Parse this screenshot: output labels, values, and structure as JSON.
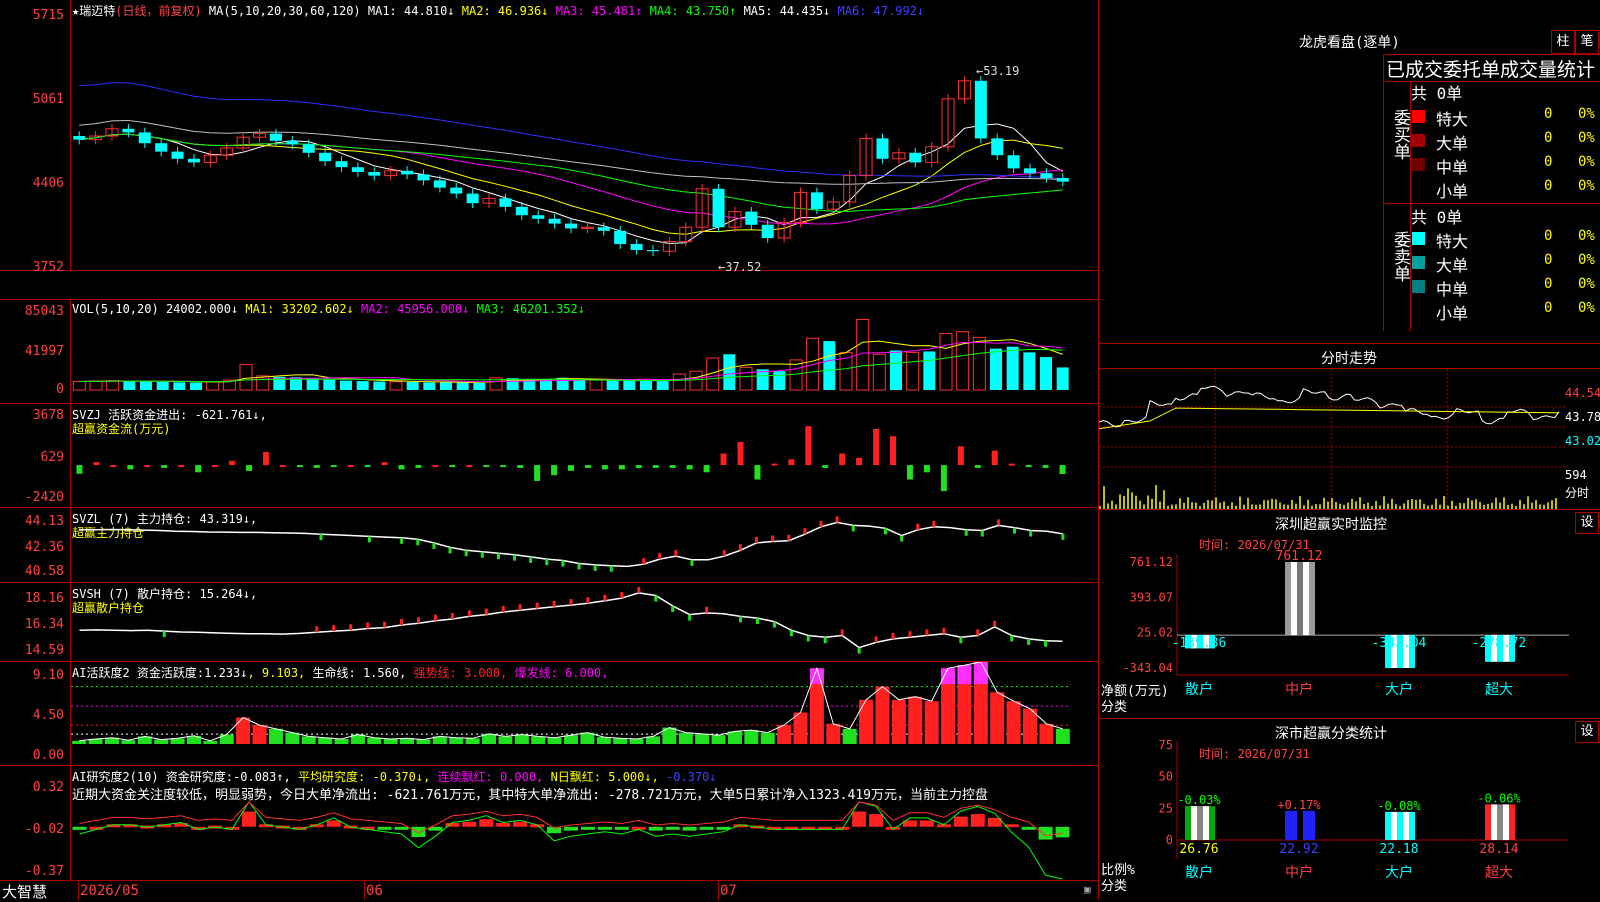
{
  "main": {
    "title": "★瑞迈特",
    "period": "(日线，前复权)",
    "ma_params": "MA(5,10,20,30,60,120)",
    "ma": [
      {
        "label": "MA1:",
        "value": "44.810↓",
        "color": "#ffffff"
      },
      {
        "label": "MA2:",
        "value": "46.936↓",
        "color": "#ffff00"
      },
      {
        "label": "MA3:",
        "value": "45.481↑",
        "color": "#ff00ff"
      },
      {
        "label": "MA4:",
        "value": "43.750↑",
        "color": "#00ff00"
      },
      {
        "label": "MA5:",
        "value": "44.435↓",
        "color": "#ffffff"
      },
      {
        "label": "MA6:",
        "value": "47.992↓",
        "color": "#4040ff"
      }
    ],
    "yticks": [
      "5715",
      "5061",
      "4406",
      "3752"
    ],
    "high_label": "←53.19",
    "low_label": "←37.52"
  },
  "vol": {
    "header": "VOL(5,10,20)",
    "value": "24002.000↓",
    "ma": [
      {
        "label": "MA1:",
        "value": "33202.602↓",
        "color": "#ffff00"
      },
      {
        "label": "MA2:",
        "value": "45956.000↓",
        "color": "#ff00ff"
      },
      {
        "label": "MA3:",
        "value": "46201.352↓",
        "color": "#00ff00"
      }
    ],
    "yticks": [
      "85043",
      "41997",
      "0"
    ]
  },
  "svzj": {
    "header": "SVZJ  活跃资金进出:",
    "value": "-621.761↓,",
    "sub": "超赢资金流(万元)",
    "yticks": [
      "3678",
      "629",
      "-2420"
    ]
  },
  "svzl": {
    "header": "SVZL (7) 主力持仓:",
    "value": "43.319↓,",
    "sub": "超赢主力持仓",
    "yticks": [
      "44.13",
      "42.36",
      "40.58"
    ]
  },
  "svsh": {
    "header": "SVSH (7) 散户持仓:",
    "value": "15.264↓,",
    "sub": "超赢散户持仓",
    "yticks": [
      "18.16",
      "16.34",
      "14.59"
    ]
  },
  "ai1": {
    "header": "AI活跃度2 资金活跃度:",
    "v1": "1.233↓",
    "v2": ", 9.103,",
    "v3": " 生命线: 1.560,",
    "v4": " 强势线: 3.000,",
    "v5": " 爆发线: 6.000,",
    "yticks": [
      "9.10",
      "4.50",
      "0.00"
    ]
  },
  "ai2": {
    "header": "AI研究度2(10) 资金研究度:",
    "v1": "-0.083↑,",
    "v2": " 平均研究度: -0.370↓,",
    "v3": " 连续飘红: 0.000,",
    "v4": " N日飘红: 5.000↓,",
    "v5": " -0.370↓",
    "comment": "近期大资金关注度较低，明显弱势，今日大单净流出: -621.761万元，其中特大单净流出: -278.721万元，大单5日累计净入1323.419万元，当前主力控盘",
    "yticks": [
      "0.32",
      "-0.02",
      "-0.37"
    ]
  },
  "dates": {
    "brand": "大智慧",
    "d1": "2026/05",
    "d2": "06",
    "d3": "07"
  },
  "lhb": {
    "title": "龙虎看盘(逐单)",
    "btn1": "柱",
    "btn2": "笔",
    "subtitle": "已成交委托单成交量统计",
    "buy_label": "委买单",
    "sell_label": "委卖单",
    "buy_total": "共 0单",
    "sell_total": "共 0单",
    "buy_rows": [
      {
        "name": "特大",
        "count": "0",
        "pct": "0%",
        "color": "#ff0000"
      },
      {
        "name": "大单",
        "count": "0",
        "pct": "0%",
        "color": "#a00000"
      },
      {
        "name": "中单",
        "count": "0",
        "pct": "0%",
        "color": "#700000"
      },
      {
        "name": "小单",
        "count": "0",
        "pct": "0%",
        "color": "#000000"
      }
    ],
    "sell_rows": [
      {
        "name": "特大",
        "count": "0",
        "pct": "0%",
        "color": "#00ffff"
      },
      {
        "name": "大单",
        "count": "0",
        "pct": "0%",
        "color": "#00a0a0"
      },
      {
        "name": "中单",
        "count": "0",
        "pct": "0%",
        "color": "#008080"
      },
      {
        "name": "小单",
        "count": "0",
        "pct": "0%",
        "color": "#000000"
      }
    ]
  },
  "intraday": {
    "title": "分时走势",
    "yticks": [
      "44.54",
      "43.78",
      "43.02"
    ],
    "vol_label": "594",
    "time_label": "分时"
  },
  "monitor": {
    "title": "深圳超赢实时监控",
    "set": "设",
    "time": "时间: 2026/07/31",
    "yticks": [
      "761.12",
      "393.07",
      "25.02",
      "-343.04"
    ],
    "net_label": "净额(万元)",
    "cat_label": "分类",
    "bars": [
      {
        "name": "散户",
        "value": -139.36,
        "label": "-139.36"
      },
      {
        "name": "中户",
        "value": 761.12,
        "label": "761.12"
      },
      {
        "name": "大户",
        "value": -343.04,
        "label": "-343.04"
      },
      {
        "name": "超大",
        "value": -278.72,
        "label": "-278.72"
      }
    ]
  },
  "classify": {
    "title": "深市超赢分类统计",
    "set": "设",
    "time": "时间: 2026/07/31",
    "yticks": [
      "75",
      "50",
      "25",
      "0"
    ],
    "ratio_label": "比例%",
    "cat_label": "分类",
    "bars": [
      {
        "name": "散户",
        "value": 26.76,
        "label": "26.76",
        "change": "-0.03%"
      },
      {
        "name": "中户",
        "value": 22.92,
        "label": "22.92",
        "change": "+0.17%"
      },
      {
        "name": "大户",
        "value": 22.18,
        "label": "22.18",
        "change": "-0.08%"
      },
      {
        "name": "超大",
        "value": 28.14,
        "label": "28.14",
        "change": "-0.06%"
      }
    ]
  },
  "chart_data": [
    {
      "type": "candlestick",
      "title": "★瑞迈特 (日线，前复权)",
      "ylim": [
        37,
        58
      ],
      "x": [
        "2026/05",
        "06",
        "07"
      ],
      "series": [
        {
          "name": "close",
          "values": [
            47.2,
            47.5,
            48.1,
            47.8,
            46.9,
            46.2,
            45.6,
            45.3,
            45.9,
            46.5,
            47.4,
            47.7,
            47.1,
            46.8,
            46.1,
            45.4,
            44.9,
            44.5,
            44.2,
            44.6,
            44.3,
            43.8,
            43.2,
            42.7,
            41.9,
            42.3,
            41.6,
            40.9,
            40.6,
            40.2,
            39.8,
            39.9,
            39.6,
            38.5,
            38.0,
            37.9,
            38.7,
            39.9,
            43.1,
            39.9,
            41.2,
            40.1,
            39.0,
            40.3,
            42.8,
            41.4,
            42.0,
            44.2,
            47.3,
            45.6,
            46.1,
            45.3,
            46.6,
            50.6,
            52.1,
            47.3,
            45.9,
            44.8,
            44.4,
            44.0,
            43.7
          ]
        }
      ]
    },
    {
      "type": "bar",
      "title": "VOL(5,10,20)",
      "ylim": [
        0,
        85043
      ],
      "series": [
        {
          "name": "VOL",
          "values": [
            9000,
            9500,
            10000,
            9200,
            9800,
            8700,
            8200,
            7800,
            8500,
            10500,
            27000,
            15000,
            14000,
            13500,
            12000,
            11000,
            10000,
            9500,
            9000,
            8800,
            8500,
            8000,
            8200,
            7900,
            7600,
            13000,
            12500,
            11800,
            11000,
            13000,
            11500,
            10800,
            10200,
            10000,
            9800,
            9500,
            17000,
            20000,
            34000,
            38000,
            24000,
            22000,
            20000,
            32000,
            55000,
            52000,
            40000,
            75000,
            38000,
            42000,
            40000,
            41000,
            60000,
            62000,
            56000,
            44000,
            46000,
            40000,
            35000,
            24000
          ]
        }
      ]
    },
    {
      "type": "bar",
      "title": "SVZJ 活跃资金进出",
      "ylim": [
        -2420,
        3678
      ],
      "series": [
        {
          "name": "活跃资金进出",
          "values": [
            -600,
            200,
            0,
            -300,
            0,
            -200,
            0,
            -500,
            0,
            300,
            -400,
            900,
            0,
            -100,
            -200,
            -100,
            0,
            -100,
            200,
            -300,
            -200,
            0,
            -100,
            0,
            -100,
            -100,
            -200,
            -1100,
            -700,
            -400,
            -200,
            -300,
            -300,
            -200,
            -200,
            -200,
            -300,
            -500,
            800,
            1600,
            -1000,
            100,
            400,
            2700,
            -200,
            800,
            500,
            2500,
            2000,
            -1000,
            -500,
            -1800,
            1300,
            -200,
            1000,
            100,
            -100,
            -200,
            -621.761
          ]
        }
      ]
    },
    {
      "type": "line",
      "title": "SVZL (7) 主力持仓",
      "ylim": [
        40.58,
        44.13
      ],
      "series": [
        {
          "name": "主力持仓",
          "values": [
            43.6,
            43.6,
            43.62,
            43.6,
            43.58,
            43.55,
            43.5,
            43.48,
            43.45,
            43.44,
            43.42,
            43.42,
            43.4,
            43.38,
            43.35,
            43.3,
            43.25,
            43.2,
            43.15,
            43.1,
            43.05,
            42.95,
            42.7,
            42.4,
            42.2,
            42.1,
            42.0,
            41.9,
            41.75,
            41.6,
            41.5,
            41.3,
            41.2,
            41.15,
            41.1,
            41.25,
            41.6,
            41.8,
            41.55,
            41.55,
            41.8,
            42.2,
            42.7,
            42.8,
            42.85,
            43.3,
            43.8,
            44.1,
            43.9,
            43.85,
            43.7,
            43.2,
            43.6,
            43.8,
            43.75,
            43.6,
            43.55,
            43.9,
            43.75,
            43.55,
            43.5,
            43.319
          ]
        }
      ]
    },
    {
      "type": "line",
      "title": "SVSH (7) 散户持仓",
      "ylim": [
        14.59,
        18.16
      ],
      "series": [
        {
          "name": "散户持仓",
          "values": [
            15.9,
            15.92,
            15.9,
            15.88,
            15.9,
            15.85,
            15.8,
            15.78,
            15.75,
            15.72,
            15.7,
            15.7,
            15.68,
            15.72,
            15.78,
            15.85,
            15.9,
            16.0,
            16.05,
            16.2,
            16.3,
            16.45,
            16.55,
            16.7,
            16.8,
            16.95,
            17.05,
            17.15,
            17.25,
            17.35,
            17.45,
            17.6,
            17.75,
            18.05,
            17.9,
            17.3,
            16.8,
            16.9,
            16.85,
            16.7,
            16.6,
            16.4,
            15.9,
            15.6,
            15.5,
            15.6,
            14.9,
            15.2,
            15.4,
            15.5,
            15.6,
            15.7,
            15.5,
            15.6,
            16.1,
            15.6,
            15.4,
            15.3,
            15.264
          ]
        }
      ]
    },
    {
      "type": "bar",
      "title": "AI活跃度2",
      "ylim": [
        0,
        9.1
      ],
      "series": [
        {
          "name": "资金活跃度",
          "values": [
            0.5,
            0.8,
            1.0,
            0.6,
            1.2,
            0.7,
            0.9,
            1.3,
            0.5,
            1.5,
            4.2,
            3.0,
            2.4,
            1.8,
            1.2,
            1.0,
            0.8,
            1.5,
            1.0,
            0.8,
            0.9,
            0.7,
            1.2,
            1.0,
            0.9,
            1.6,
            1.2,
            1.5,
            1.2,
            1.0,
            1.4,
            1.8,
            1.1,
            0.9,
            0.8,
            1.2,
            2.6,
            1.8,
            1.6,
            1.4,
            2.0,
            2.2,
            1.8,
            3.0,
            5.0,
            12.0,
            3.2,
            2.4,
            7.0,
            9.103,
            7.0,
            7.5,
            6.8,
            12.0,
            12.5,
            13.0,
            8.2,
            6.8,
            5.6,
            3.2,
            2.4
          ]
        }
      ]
    },
    {
      "type": "bar",
      "title": "AI研究度2(10)",
      "ylim": [
        -0.37,
        0.32
      ],
      "series": [
        {
          "name": "资金研究度",
          "values": [
            -0.02,
            0.0,
            0.02,
            0.02,
            0.01,
            0.02,
            0.03,
            0.0,
            0.01,
            0.0,
            0.12,
            0.02,
            0.01,
            0.0,
            0.02,
            0.05,
            0.01,
            0.0,
            -0.01,
            -0.02,
            -0.08,
            -0.03,
            0.03,
            0.04,
            0.06,
            0.03,
            0.04,
            0.02,
            -0.05,
            -0.03,
            -0.02,
            -0.01,
            -0.02,
            0.0,
            -0.03,
            -0.02,
            -0.03,
            -0.02,
            -0.01,
            0.02,
            0.01,
            0.0,
            0.0,
            0.0,
            0.0,
            0.0,
            0.12,
            0.1,
            0.0,
            0.05,
            0.05,
            0.02,
            0.08,
            0.1,
            0.07,
            0.02,
            -0.01,
            -0.1,
            -0.083
          ]
        }
      ]
    },
    {
      "type": "line",
      "title": "分时走势",
      "ylim": [
        43.02,
        44.54
      ],
      "series": [
        {
          "name": "price",
          "values": [
            43.6,
            43.7,
            44.1,
            44.3,
            44.5,
            44.4,
            44.3,
            44.2,
            44.4,
            44.3,
            44.2,
            44.1,
            43.9,
            43.8,
            43.9,
            43.7,
            43.9,
            43.8,
            43.9
          ]
        }
      ]
    },
    {
      "type": "bar",
      "title": "深圳超赢实时监控",
      "categories": [
        "散户",
        "中户",
        "大户",
        "超大"
      ],
      "ylabel": "净额(万元)",
      "ylim": [
        -343.04,
        761.12
      ],
      "values": [
        -139.36,
        761.12,
        -343.04,
        -278.72
      ]
    },
    {
      "type": "bar",
      "title": "深市超赢分类统计",
      "categories": [
        "散户",
        "中户",
        "大户",
        "超大"
      ],
      "ylabel": "比例%",
      "ylim": [
        0,
        75
      ],
      "values": [
        26.76,
        22.92,
        22.18,
        28.14
      ]
    }
  ]
}
